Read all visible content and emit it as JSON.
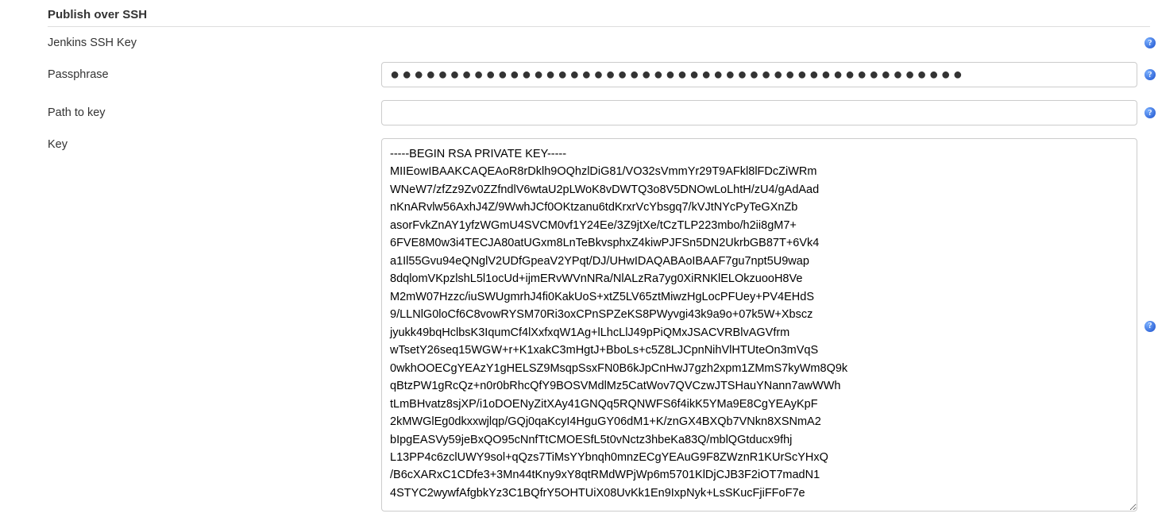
{
  "section": {
    "title": "Publish over SSH"
  },
  "jenkins_key": {
    "label": "Jenkins SSH Key"
  },
  "passphrase": {
    "label": "Passphrase",
    "value_masked": "●●●●●●●●●●●●●●●●●●●●●●●●●●●●●●●●●●●●●●●●●●●●●●●●"
  },
  "path_to_key": {
    "label": "Path to key",
    "value": ""
  },
  "key": {
    "label": "Key",
    "value": "-----BEGIN RSA PRIVATE KEY-----\nMIIEowIBAAKCAQEAoR8rDklh9OQhzlDiG81/VO32sVmmYr29T9AFkl8lFDcZiWRm\nWNeW7/zfZz9Zv0ZZfndlV6wtaU2pLWoK8vDWTQ3o8V5DNOwLoLhtH/zU4/gAdAad\nnKnARvlw56AxhJ4Z/9WwhJCf0OKtzanu6tdKrxrVcYbsgq7/kVJtNYcPyTeGXnZb\nasorFvkZnAY1yfzWGmU4SVCM0vf1Y24Ee/3Z9jtXe/tCzTLP223mbo/h2ii8gM7+\n6FVE8M0w3i4TECJA80atUGxm8LnTeBkvsphxZ4kiwPJFSn5DN2UkrbGB87T+6Vk4\na1Il55Gvu94eQNglV2UDfGpeaV2YPqt/DJ/UHwIDAQABAoIBAAF7gu7npt5U9wap\n8dqlomVKpzlshL5l1ocUd+ijmERvWVnNRa/NlALzRa7yg0XiRNKlELOkzuooH8Ve\nM2mW07Hzzc/iuSWUgmrhJ4fi0KakUoS+xtZ5LV65ztMiwzHgLocPFUey+PV4EHdS\n9/LLNlG0loCf6C8vowRYSM70Ri3oxCPnSPZeKS8PWyvgi43k9a9o+07k5W+Xbscz\njyukk49bqHclbsK3IqumCf4lXxfxqW1Ag+lLhcLlJ49pPiQMxJSACVRBlvAGVfrm\nwTsetY26seq15WGW+r+K1xakC3mHgtJ+BboLs+c5Z8LJCpnNihVlHTUteOn3mVqS\n0wkhOOECgYEAzY1gHELSZ9MsqpSsxFN0B6kJpCnHwJ7gzh2xpm1ZMmS7kyWm8Q9k\nqBtzPW1gRcQz+n0r0bRhcQfY9BOSVMdlMz5CatWov7QVCzwJTSHauYNann7awWWh\ntLmBHvatz8sjXP/i1oDOENyZitXAy41GNQq5RQNWFS6f4ikK5YMa9E8CgYEAyKpF\n2kMWGlEg0dkxxwjlqp/GQj0qaKcyI4HguGY06dM1+K/znGX4BXQb7VNkn8XSNmA2\nbIpgEASVy59jeBxQO95cNnfTtCMOESfL5t0vNctz3hbeKa83Q/mblQGtducx9fhj\nL13PP4c6zclUWY9sol+qQzs7TiMsYYbnqh0mnzECgYEAuG9F8ZWznR1KUrScYHxQ\n/B6cXARxC1CDfe3+3Mn44tKny9xY8qtRMdWPjWp6m5701KlDjCJB3F2iOT7madN1\n4STYC2wywfAfgbkYz3C1BQfrY5OHTUiX08UvKk1En9IxpNyk+LsSKucFjiFFoF7e"
  },
  "help": {
    "glyph": "?"
  }
}
